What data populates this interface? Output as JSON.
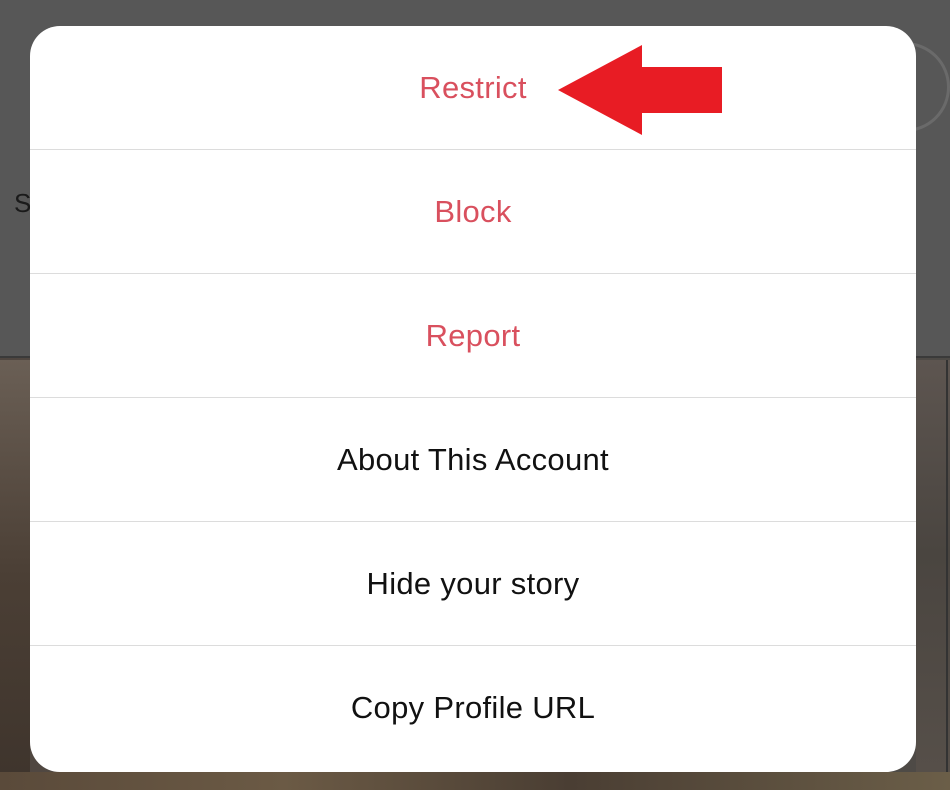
{
  "background": {
    "partial_label": "S"
  },
  "action_sheet": {
    "items": [
      {
        "label": "Restrict",
        "style": "danger"
      },
      {
        "label": "Block",
        "style": "danger"
      },
      {
        "label": "Report",
        "style": "danger"
      },
      {
        "label": "About This Account",
        "style": "normal"
      },
      {
        "label": "Hide your story",
        "style": "normal"
      },
      {
        "label": "Copy Profile URL",
        "style": "normal"
      }
    ]
  },
  "annotation": {
    "arrow_icon": "arrow-left-icon",
    "arrow_color": "#e81c24"
  },
  "colors": {
    "danger_text": "#d9505e",
    "normal_text": "#111111",
    "separator": "#dcdcdc"
  }
}
